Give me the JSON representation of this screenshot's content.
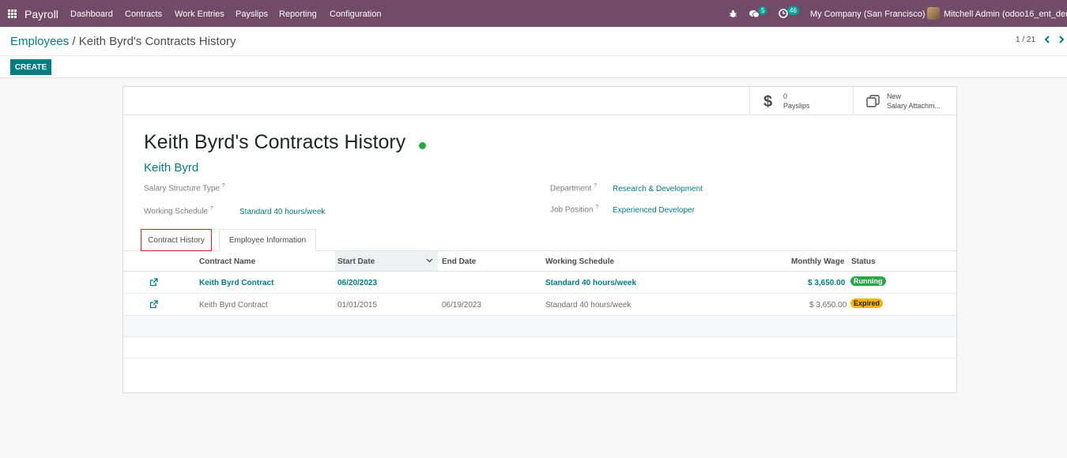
{
  "navbar": {
    "brand": "Payroll",
    "menu": [
      "Dashboard",
      "Contracts",
      "Work Entries",
      "Payslips",
      "Reporting",
      "Configuration"
    ],
    "messages_count": "5",
    "activities_count": "46",
    "company": "My Company (San Francisco)",
    "user": "Mitchell Admin (odoo16_ent_demo)"
  },
  "control_panel": {
    "breadcrumb_parent": "Employees",
    "breadcrumb_separator": "/",
    "breadcrumb_current": "Keith Byrd's Contracts History",
    "create_label": "CREATE",
    "pager": "1 / 21"
  },
  "stat_buttons": {
    "payslips_value": "0",
    "payslips_label": "Payslips",
    "salary_value": "New",
    "salary_label": "Salary Attachm..."
  },
  "form": {
    "title": "Keith Byrd's Contracts History",
    "employee": "Keith Byrd",
    "salary_structure_label": "Salary Structure Type",
    "working_schedule_label": "Working Schedule",
    "working_schedule_value": "Standard 40 hours/week",
    "department_label": "Department",
    "department_value": "Research & Development",
    "job_position_label": "Job Position",
    "job_position_value": "Experienced Developer",
    "help_mark": "?"
  },
  "tabs": [
    "Contract History",
    "Employee Information"
  ],
  "table": {
    "headers": [
      "Contract Name",
      "Start Date",
      "End Date",
      "Working Schedule",
      "Monthly Wage",
      "Status"
    ],
    "rows": [
      {
        "name": "Keith Byrd Contract",
        "start": "06/20/2023",
        "end": "",
        "schedule": "Standard 40 hours/week",
        "wage": "$ 3,650.00",
        "status": "Running"
      },
      {
        "name": "Keith Byrd Contract",
        "start": "01/01/2015",
        "end": "06/19/2023",
        "schedule": "Standard 40 hours/week",
        "wage": "$ 3,650.00",
        "status": "Expired"
      }
    ]
  },
  "colors": {
    "navbar": "#714b67",
    "primary": "#017e84",
    "running": "#28a745",
    "expired": "#f5b400"
  }
}
